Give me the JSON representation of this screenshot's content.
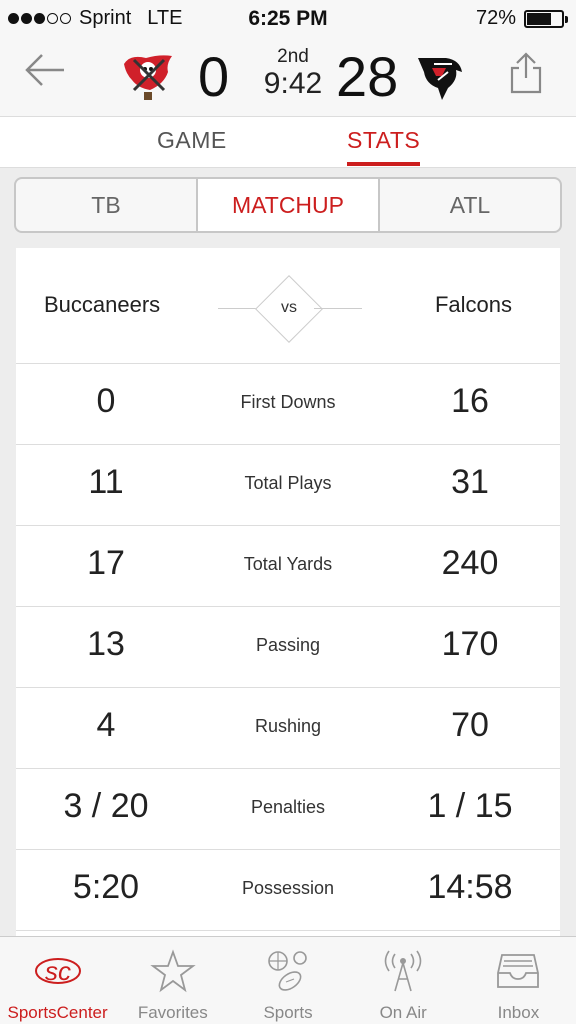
{
  "status_bar": {
    "carrier": "Sprint",
    "network": "LTE",
    "time": "6:25 PM",
    "battery": "72%",
    "battery_level": 0.72
  },
  "score_header": {
    "home_team": "TB",
    "away_team": "ATL",
    "home_score": "0",
    "away_score": "28",
    "period": "2nd",
    "clock": "9:42",
    "icons": {
      "back": "back-arrow-icon",
      "share": "share-icon",
      "home_logo": "buccaneers-logo",
      "away_logo": "falcons-logo"
    }
  },
  "top_tabs": [
    {
      "label": "GAME",
      "active": false
    },
    {
      "label": "STATS",
      "active": true
    }
  ],
  "segmented": [
    {
      "label": "TB",
      "active": false
    },
    {
      "label": "MATCHUP",
      "active": true
    },
    {
      "label": "ATL",
      "active": false
    }
  ],
  "matchup": {
    "home_name": "Buccaneers",
    "away_name": "Falcons",
    "vs": "vs"
  },
  "stats": [
    {
      "label": "First Downs",
      "home": "0",
      "away": "16"
    },
    {
      "label": "Total Plays",
      "home": "11",
      "away": "31"
    },
    {
      "label": "Total Yards",
      "home": "17",
      "away": "240"
    },
    {
      "label": "Passing",
      "home": "13",
      "away": "170"
    },
    {
      "label": "Rushing",
      "home": "4",
      "away": "70"
    },
    {
      "label": "Penalties",
      "home": "3 / 20",
      "away": "1 / 15"
    },
    {
      "label": "Possession",
      "home": "5:20",
      "away": "14:58"
    }
  ],
  "tab_bar": [
    {
      "label": "SportsCenter",
      "icon": "sportscenter-icon",
      "active": true
    },
    {
      "label": "Favorites",
      "icon": "star-icon",
      "active": false
    },
    {
      "label": "Sports",
      "icon": "sports-balls-icon",
      "active": false
    },
    {
      "label": "On Air",
      "icon": "broadcast-tower-icon",
      "active": false
    },
    {
      "label": "Inbox",
      "icon": "inbox-tray-icon",
      "active": false
    }
  ],
  "colors": {
    "accent": "#cc1e1e",
    "background": "#ededed",
    "card": "#ffffff"
  }
}
